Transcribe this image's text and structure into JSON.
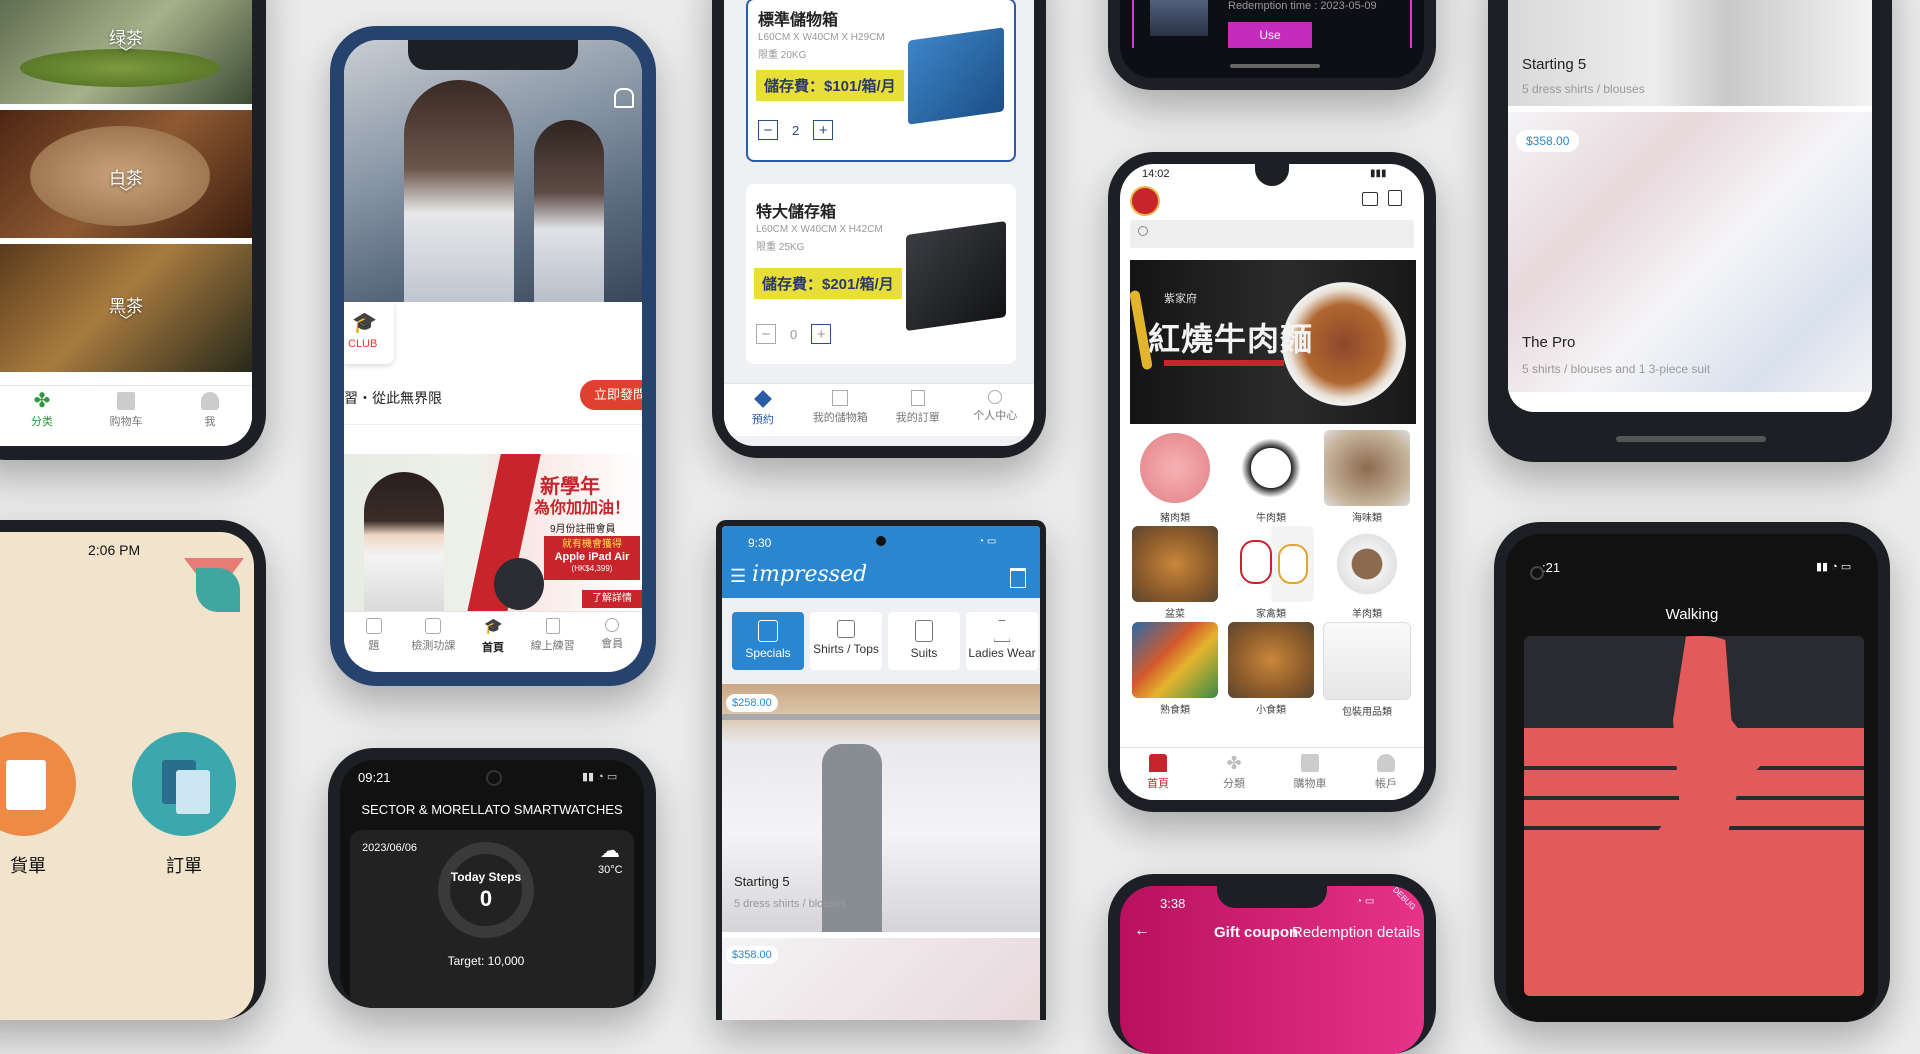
{
  "tea_app": {
    "categories": [
      {
        "label": "绿茶"
      },
      {
        "label": "白茶"
      },
      {
        "label": "黑茶"
      }
    ],
    "tabs": [
      {
        "label": "分类"
      },
      {
        "label": "购物车"
      },
      {
        "label": "我"
      }
    ]
  },
  "school_app": {
    "club_label": "CLUB",
    "slogan": "習・從此無界限",
    "cta": "立即發問",
    "banner": {
      "title": "新學年",
      "subtitle": "為你加加油！",
      "line1": "9月份註冊會員",
      "line2": "就有機會獲得",
      "prize": "Apple iPad Air",
      "price": "(HK$4,399)",
      "more": "了解詳情"
    },
    "tabs": [
      {
        "label": "題"
      },
      {
        "label": "檢測功課"
      },
      {
        "label": "首頁"
      },
      {
        "label": "線上練習"
      },
      {
        "label": "會員"
      }
    ]
  },
  "storage_app": {
    "cards": [
      {
        "title": "標準儲物箱",
        "dims": "L60CM X W40CM X H29CM",
        "limit": "限重 20KG",
        "price": "儲存費：$101/箱/月",
        "qty": "2"
      },
      {
        "title": "特大儲存箱",
        "dims": "L60CM X W40CM X H42CM",
        "limit": "限重 25KG",
        "price": "儲存費：$201/箱/月",
        "qty": "0"
      }
    ],
    "tabs": [
      {
        "label": "預約"
      },
      {
        "label": "我的儲物箱"
      },
      {
        "label": "我的訂單"
      },
      {
        "label": "个人中心"
      }
    ]
  },
  "coupon_top": {
    "text": "Redemption time : 2023-05-09",
    "button": "Use"
  },
  "food_app": {
    "banner": {
      "brand": "紫家府",
      "title": "紅燒牛肉麵"
    },
    "items": [
      {
        "label": "豬肉類"
      },
      {
        "label": "牛肉類"
      },
      {
        "label": "海味類"
      },
      {
        "label": "盆菜"
      },
      {
        "label": "家禽類"
      },
      {
        "label": "羊肉類"
      },
      {
        "label": "熟食類"
      },
      {
        "label": "小食類"
      },
      {
        "label": "包裝用品類"
      }
    ],
    "status_time": "14:02",
    "tabs": [
      {
        "label": "首頁"
      },
      {
        "label": "分類"
      },
      {
        "label": "購物車"
      },
      {
        "label": "帳戶"
      }
    ]
  },
  "shirts_top": {
    "title1": "Starting 5",
    "sub1": "5 dress shirts / blouses",
    "price": "$358.00",
    "title2": "The Pro",
    "sub2": "5 shirts / blouses and 1 3-piece suit"
  },
  "notes_app": {
    "time": "2:06 PM",
    "buttons": [
      {
        "label": "貨單"
      },
      {
        "label": "訂單"
      }
    ]
  },
  "watch_app": {
    "time": "09:21",
    "title": "SECTOR & MORELLATO SMARTWATCHES",
    "date": "2023/06/06",
    "steps_label": "Today Steps",
    "steps": "0",
    "temp": "30°C",
    "target": "Target: 10,000"
  },
  "impressed_app": {
    "time": "9:30",
    "logo": "impressed",
    "categories": [
      {
        "label": "Specials"
      },
      {
        "label": "Shirts / Tops"
      },
      {
        "label": "Suits"
      },
      {
        "label": "Ladies Wear"
      }
    ],
    "price": "$258.00",
    "title": "Starting 5",
    "sub": "5 dress shirts / blouses",
    "price2": "$358.00"
  },
  "coupon_app": {
    "time": "3:38",
    "title": "Gift coupon",
    "tab": "Redemption details",
    "badge": "DEBUG"
  },
  "walk_app": {
    "time": ":21",
    "title": "Walking"
  }
}
